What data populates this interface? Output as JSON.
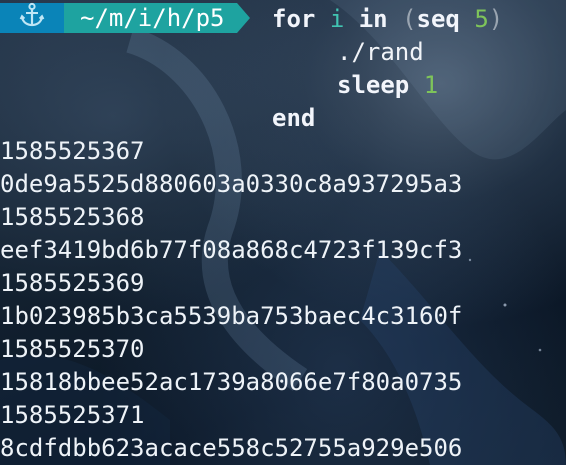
{
  "prompt": {
    "anchor_icon": "anchor-icon",
    "path": "~/m/i/h/p5",
    "colors": {
      "anchor_bg": "#0a84b8",
      "path_bg": "#1ea3a0"
    }
  },
  "command": {
    "line1": {
      "for": "for",
      "var": "i",
      "in": "in",
      "open": "(",
      "seq": "seq",
      "num": "5",
      "close": ")"
    },
    "line2": "./rand",
    "line3": {
      "sleep": "sleep",
      "num": "1"
    },
    "line4": "end"
  },
  "output": [
    "1585525367",
    "0de9a5525d880603a0330c8a937295a3",
    "1585525368",
    "eef3419bd6b77f08a868c4723f139cf3",
    "1585525369",
    "1b023985b3ca5539ba753baec4c3160f",
    "1585525370",
    "15818bbee52ac1739a8066e7f80a0735",
    "1585525371",
    "8cdfdbb623acace558c52755a929e506"
  ],
  "colors": {
    "keyword": "#f2f5fb",
    "variable": "#41c4b2",
    "number": "#7ec45a",
    "text": "#eef3f8"
  }
}
